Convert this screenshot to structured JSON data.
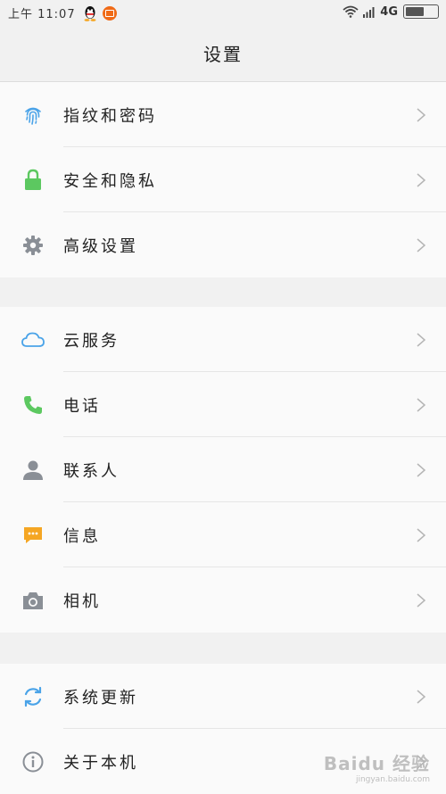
{
  "status_bar": {
    "time": "上午 11:07",
    "network": "4G",
    "battery_level": 0.6
  },
  "header": {
    "title": "设置"
  },
  "groups": [
    {
      "items": [
        {
          "label": "指纹和密码",
          "icon": "fingerprint-icon",
          "color": "#4aa3e8"
        },
        {
          "label": "安全和隐私",
          "icon": "lock-icon",
          "color": "#5cc860"
        },
        {
          "label": "高级设置",
          "icon": "gear-icon",
          "color": "#8a8f96"
        }
      ]
    },
    {
      "items": [
        {
          "label": "云服务",
          "icon": "cloud-icon",
          "color": "#4aa3e8"
        },
        {
          "label": "电话",
          "icon": "phone-icon",
          "color": "#5cc860"
        },
        {
          "label": "联系人",
          "icon": "contact-icon",
          "color": "#8a8f96"
        },
        {
          "label": "信息",
          "icon": "message-icon",
          "color": "#f5a623"
        },
        {
          "label": "相机",
          "icon": "camera-icon",
          "color": "#8a8f96"
        }
      ]
    },
    {
      "items": [
        {
          "label": "系统更新",
          "icon": "update-icon",
          "color": "#4aa3e8"
        },
        {
          "label": "关于本机",
          "icon": "info-icon",
          "color": "#8a8f96"
        }
      ]
    }
  ],
  "watermark": {
    "text": "Baidu 经验",
    "sub": "jingyan.baidu.com"
  }
}
